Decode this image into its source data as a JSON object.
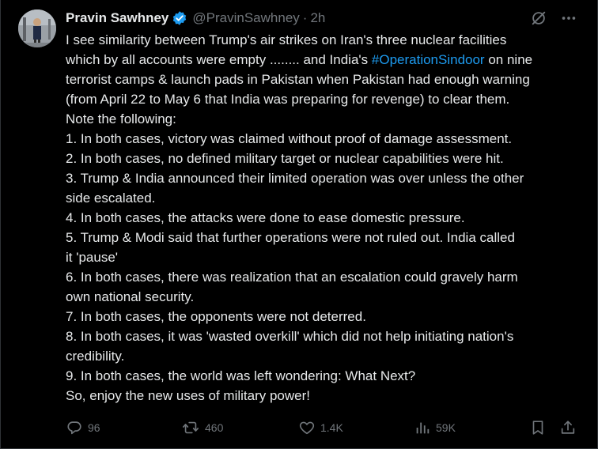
{
  "author": {
    "name": "Pravin Sawhney",
    "handle": "@PravinSawhney",
    "separator": "·",
    "time": "2h",
    "verified_icon": "verified-badge-icon",
    "avatar_icon": "profile-photo"
  },
  "header_actions": {
    "grok_icon": "grok-icon",
    "more_icon": "more-icon"
  },
  "tweet": {
    "line1": "I see similarity between Trump's air strikes on Iran's three nuclear facilities",
    "line2": "which by all accounts were empty ........ and India's",
    "hashtag": "#OperationSindoor",
    "line2_end": " on nine",
    "line3": "terrorist camps & launch pads in Pakistan when Pakistan had enough warning",
    "line4": "(from April 22 to May 6 that India was preparing for revenge) to clear them.",
    "line5": "Note the following:",
    "line6": "1. In both cases, victory was claimed without proof of damage assessment.",
    "line7": "2. In both cases, no defined military target or nuclear capabilities were hit.",
    "line8": "3. Trump & India announced their limited operation was over unless the other",
    "line9": "side escalated.",
    "line10": "4. In both cases, the attacks were done to ease domestic pressure.",
    "line11": "5. Trump & Modi said that further operations were not ruled out. India called",
    "line12": "it 'pause'",
    "line13": "6. In both cases, there was realization that an escalation could gravely harm",
    "line14": "own national security.",
    "line15": "7. In both cases, the opponents were not deterred.",
    "line16": "8. In both cases, it was 'wasted overkill' which did not help initiating nation's",
    "line17": "credibility.",
    "line18": "9. In both cases, the world was left wondering: What Next?",
    "line19": "So, enjoy the new uses of military power!"
  },
  "actions": {
    "replies": "96",
    "reposts": "460",
    "likes": "1.4K",
    "views": "59K"
  },
  "colors": {
    "background": "#000000",
    "text": "#e7e9ea",
    "muted": "#71767b",
    "accent": "#1d9bf0"
  }
}
